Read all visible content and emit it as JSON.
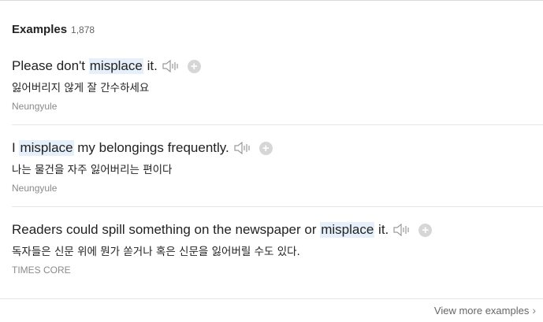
{
  "header": {
    "title": "Examples",
    "count": "1,878"
  },
  "examples": [
    {
      "en_before": "Please don't ",
      "en_highlight": "misplace",
      "en_after": " it.",
      "ko": "잃어버리지 않게 잘 간수하세요",
      "source": "Neungyule"
    },
    {
      "en_before": "I ",
      "en_highlight": "misplace",
      "en_after": " my belongings frequently.",
      "ko": "나는 물건을 자주 잃어버리는 편이다",
      "source": "Neungyule"
    },
    {
      "en_before": "Readers could spill something on the newspaper or ",
      "en_highlight": "misplace",
      "en_after": " it.",
      "ko": "독자들은 신문 위에 뭔가 쏟거나 혹은 신문을 잃어버릴 수도 있다.",
      "source": "TIMES CORE"
    }
  ],
  "footer": {
    "view_more": "View more examples"
  },
  "icons": {
    "speaker": "speaker-icon",
    "add": "plus-circle-icon",
    "more": "chevron-right-icon"
  },
  "colors": {
    "highlight": "#e6f0fb",
    "text": "#222222",
    "source": "#8a8a8a",
    "icon": "#d6d6d6"
  }
}
